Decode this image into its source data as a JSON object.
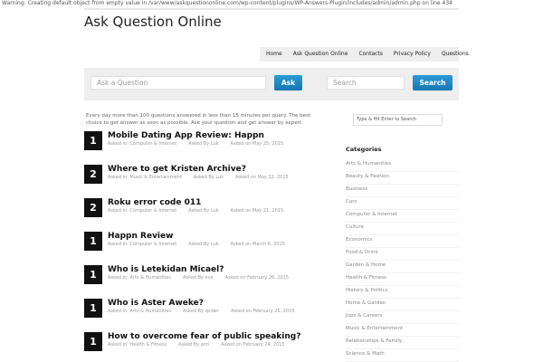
{
  "warning": "Warning: Creating default object from empty value in /var/www/askquestiononline.com/wp-content/plugins/WP-Answers-Plugin/includes/admin/admin.php on line 434",
  "site": {
    "title": "Ask Question Online"
  },
  "nav": {
    "items": [
      "Home",
      "Ask Question Online",
      "Contacts",
      "Privacy Policy",
      "Questions"
    ]
  },
  "search": {
    "ask_placeholder": "Ask a Question",
    "ask_button": "Ask",
    "search_placeholder": "Search",
    "search_button": "Search"
  },
  "intro": "Every day more than 100 questions answered in less than 15 minutes per query. The best choice to get answer as soon as possible. Ask your question and get answer by expert.",
  "questions": [
    {
      "rank": "1",
      "title": "Mobile Dating App Review: Happn",
      "category": "Asked in: Computer & Internet",
      "author": "Asked By Luk",
      "date": "Asked on May 25, 2015"
    },
    {
      "rank": "2",
      "title": "Where to get Kristen Archive?",
      "category": "Asked in: Music & Entertainment",
      "author": "Asked By Luk",
      "date": "Asked on May 22, 2015"
    },
    {
      "rank": "2",
      "title": "Roku error code 011",
      "category": "Asked in: Computer & Internet",
      "author": "Asked By Luk",
      "date": "Asked on May 21, 2015"
    },
    {
      "rank": "1",
      "title": "Happn Review",
      "category": "Asked in: Computer & Internet",
      "author": "Asked By Luk",
      "date": "Asked on March 6, 2015"
    },
    {
      "rank": "1",
      "title": "Who is Letekidan Micael?",
      "category": "Asked in: Arts & Humanities",
      "author": "Asked By eve",
      "date": "Asked on February 26, 2015"
    },
    {
      "rank": "1",
      "title": "Who is Aster Aweke?",
      "category": "Asked in: Arts & Humanities",
      "author": "Asked By spider",
      "date": "Asked on February 25, 2015"
    },
    {
      "rank": "1",
      "title": "How to overcome fear of public speaking?",
      "category": "Asked in: Health & Fitness",
      "author": "Asked By ann",
      "date": "Asked on February 24, 2015"
    }
  ],
  "sidebar": {
    "search_placeholder": "Type & Hit Enter to Search",
    "categories_heading": "Categories",
    "categories": [
      "Arts & Humanities",
      "Beauty & Fashion",
      "Business",
      "Cars",
      "Computer & Internet",
      "Culture",
      "Economics",
      "Food & Drink",
      "Garden & Home",
      "Health & Fitness",
      "History & Politics",
      "Home & Garden",
      "Jobs & Careers",
      "Music & Entertainment",
      "Relationships & Family",
      "Science & Math"
    ]
  }
}
